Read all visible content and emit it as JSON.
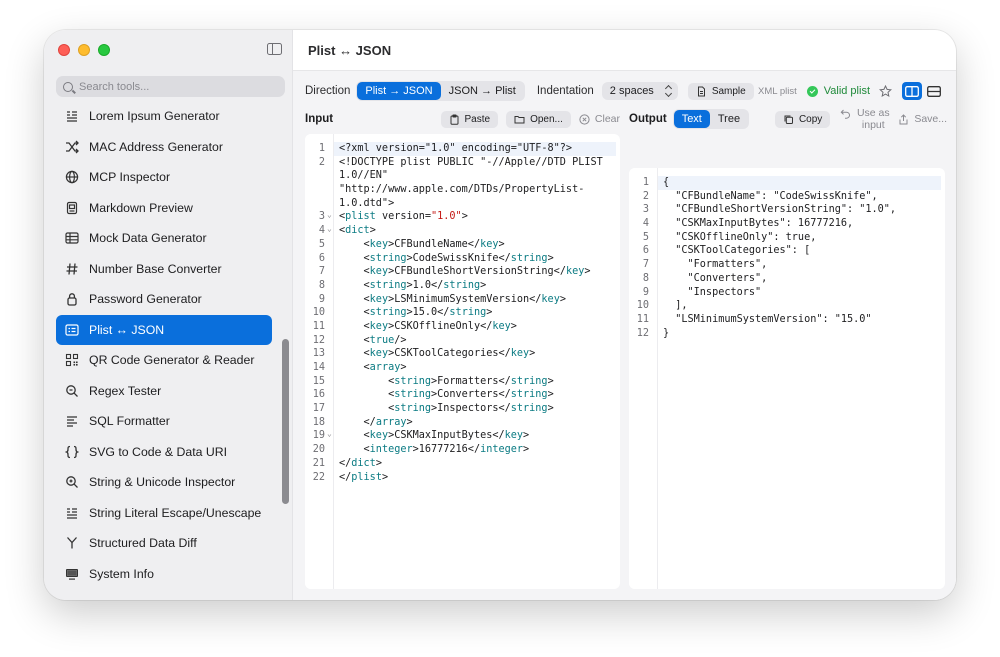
{
  "window": {
    "title": "Plist ↔ JSON"
  },
  "sidebar": {
    "search_placeholder": "Search tools...",
    "items": [
      {
        "label": "Lorem Ipsum Generator",
        "icon": "text-lines-icon"
      },
      {
        "label": "MAC Address Generator",
        "icon": "shuffle-icon"
      },
      {
        "label": "MCP Inspector",
        "icon": "globe-icon"
      },
      {
        "label": "Markdown Preview",
        "icon": "document-icon"
      },
      {
        "label": "Mock Data Generator",
        "icon": "table-icon"
      },
      {
        "label": "Number Base Converter",
        "icon": "hash-icon"
      },
      {
        "label": "Password Generator",
        "icon": "lock-icon"
      },
      {
        "label": "Plist ↔ JSON",
        "icon": "list-icon",
        "active": true
      },
      {
        "label": "QR Code Generator & Reader",
        "icon": "qrcode-icon"
      },
      {
        "label": "Regex Tester",
        "icon": "magnifier-icon"
      },
      {
        "label": "SQL Formatter",
        "icon": "align-left-icon"
      },
      {
        "label": "SVG to Code & Data URI",
        "icon": "braces-icon"
      },
      {
        "label": "String & Unicode Inspector",
        "icon": "magnifier-icon"
      },
      {
        "label": "String Literal Escape/Unescape",
        "icon": "text-lines-icon"
      },
      {
        "label": "Structured Data Diff",
        "icon": "fork-icon"
      },
      {
        "label": "System Info",
        "icon": "monitor-icon"
      }
    ]
  },
  "toolbar": {
    "direction_label": "Direction",
    "direction_options": [
      "Plist → JSON",
      "JSON → Plist"
    ],
    "direction_selected": "Plist → JSON",
    "indentation_label": "Indentation",
    "indentation_value": "2 spaces",
    "sample_label": "Sample",
    "format_label": "XML plist",
    "status_label": "Valid plist"
  },
  "input": {
    "title": "Input",
    "paste_label": "Paste",
    "open_label": "Open...",
    "clear_label": "Clear"
  },
  "output": {
    "title": "Output",
    "tabs": [
      "Text",
      "Tree"
    ],
    "tab_selected": "Text",
    "copy_label": "Copy",
    "use_as_input_label": "Use as input",
    "save_label": "Save..."
  },
  "colors": {
    "accent": "#0a6fdc",
    "valid": "#34c759",
    "tag": "#0b7b83",
    "string": "#c41a16"
  }
}
